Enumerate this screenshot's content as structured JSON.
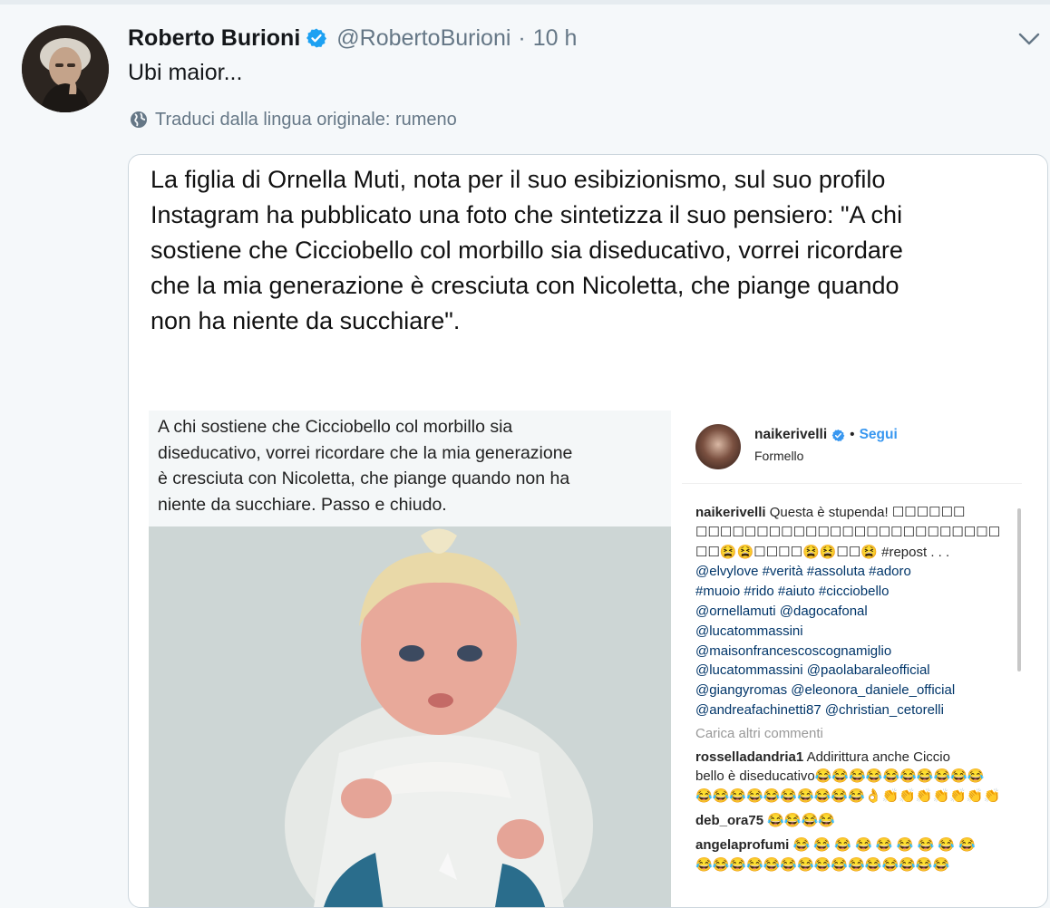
{
  "tweet": {
    "author_name": "Roberto Burioni",
    "author_handle": "@RobertoBurioni",
    "separator": "·",
    "time": "10 h",
    "text": "Ubi maior...",
    "translate_label": "Traduci dalla lingua originale: rumeno"
  },
  "media": {
    "news_lines": [
      "La figlia di Ornella Muti, nota per il suo esibizionismo, sul suo profilo",
      "Instagram ha pubblicato una foto che sintetizza il suo pensiero: \"A chi",
      "sostiene che Cicciobello col morbillo sia diseducativo, vorrei ricordare",
      "che la mia generazione è cresciuta con Nicoletta, che piange quando",
      "non ha niente da succhiare\"."
    ],
    "quote_lines": [
      "A chi sostiene che Cicciobello col morbillo sia",
      "diseducativo, vorrei ricordare che la mia generazione",
      "è cresciuta con Nicoletta, che piange quando non ha",
      "niente da succhiare. Passo e chiudo."
    ],
    "instagram": {
      "username": "naikerivelli",
      "separator": "•",
      "follow_label": "Segui",
      "location": "Formello",
      "caption_user": "naikerivelli",
      "caption_lines": [
        " Questa è stupenda! ☐☐☐☐☐☐",
        "☐☐☐☐☐☐☐☐☐☐☐☐☐☐☐☐☐☐☐☐☐☐☐☐☐",
        "☐☐😫😫☐☐☐☐😫😫☐☐😫 #repost . . .",
        "@elvylove #verità #assoluta #adoro",
        "#muoio #rido #aiuto #cicciobello",
        "@ornellamuti @dagocafonal",
        "@lucatommassini",
        "@maisonfrancescoscognamiglio",
        "@lucatommassini @paolabaraleofficial",
        "@giangyromas @eleonora_daniele_official",
        "@andreafachinetti87 @christian_cetorelli"
      ],
      "load_more": "Carica altri commenti",
      "comments": [
        {
          "user": "rosselladandria1",
          "lines": [
            " Addirittura anche Ciccio",
            "bello è diseducativo😂😂😂😂😂😂😂😂😂😂",
            "😂😂😂😂😂😂😂😂😂😂👌👏👏👏👏👏👏👏"
          ]
        },
        {
          "user": "deb_ora75",
          "lines": [
            " 😂😂😂😂"
          ]
        },
        {
          "user": "angelaprofumi",
          "lines": [
            " 😂 😂 😂 😂 😂 😂 😂 😂 😂",
            "😂😂😂😂😂😂😂😂😂😂😂😂😂😂😂"
          ]
        }
      ]
    }
  },
  "colors": {
    "background": "#f5f8fa",
    "secondary_text": "#657786",
    "verified_blue": "#1da1f2",
    "ig_link": "#3897f0",
    "ig_tag": "#003569"
  },
  "icons": {
    "verified": "verified-badge-icon",
    "chevron": "chevron-down-icon",
    "globe": "globe-icon"
  }
}
